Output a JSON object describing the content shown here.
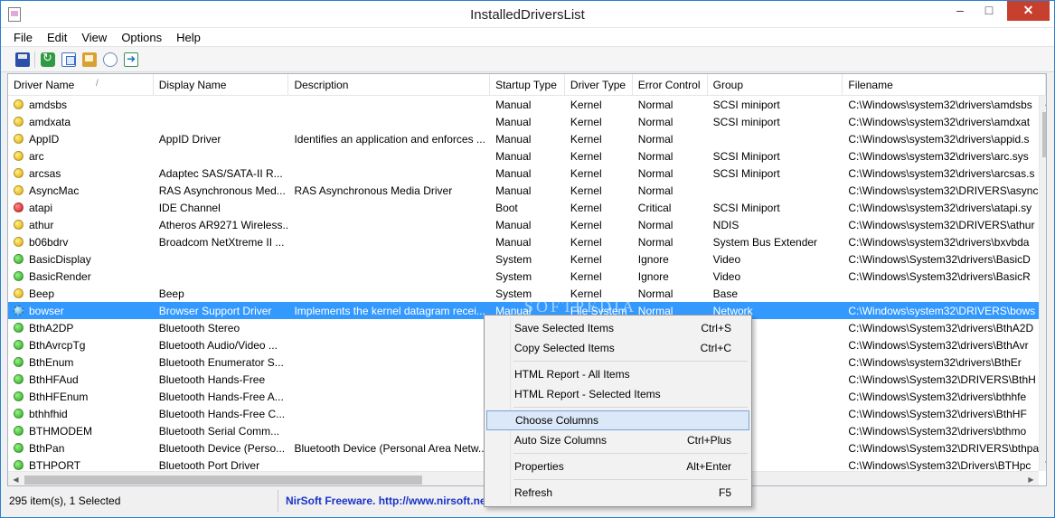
{
  "window": {
    "title": "InstalledDriversList"
  },
  "menu": [
    "File",
    "Edit",
    "View",
    "Options",
    "Help"
  ],
  "toolbar": [
    "save-icon",
    "refresh-icon",
    "copy-icon",
    "properties-icon",
    "find-icon",
    "exit-icon"
  ],
  "columns": [
    "Driver Name",
    "Display Name",
    "Description",
    "Startup Type",
    "Driver Type",
    "Error Control",
    "Group",
    "Filename"
  ],
  "rows": [
    {
      "status": "yellow",
      "cells": [
        "amdsbs",
        "",
        "",
        "Manual",
        "Kernel",
        "Normal",
        "SCSI miniport",
        "C:\\Windows\\system32\\drivers\\amdsbs"
      ]
    },
    {
      "status": "yellow",
      "cells": [
        "amdxata",
        "",
        "",
        "Manual",
        "Kernel",
        "Normal",
        "SCSI miniport",
        "C:\\Windows\\system32\\drivers\\amdxat"
      ]
    },
    {
      "status": "yellow",
      "cells": [
        "AppID",
        "AppID Driver",
        "Identifies an application and enforces ...",
        "Manual",
        "Kernel",
        "Normal",
        "",
        "C:\\Windows\\system32\\drivers\\appid.s"
      ]
    },
    {
      "status": "yellow",
      "cells": [
        "arc",
        "",
        "",
        "Manual",
        "Kernel",
        "Normal",
        "SCSI Miniport",
        "C:\\Windows\\system32\\drivers\\arc.sys"
      ]
    },
    {
      "status": "yellow",
      "cells": [
        "arcsas",
        "Adaptec SAS/SATA-II R...",
        "",
        "Manual",
        "Kernel",
        "Normal",
        "SCSI Miniport",
        "C:\\Windows\\system32\\drivers\\arcsas.s"
      ]
    },
    {
      "status": "yellow",
      "cells": [
        "AsyncMac",
        "RAS Asynchronous Med...",
        "RAS Asynchronous Media Driver",
        "Manual",
        "Kernel",
        "Normal",
        "",
        "C:\\Windows\\system32\\DRIVERS\\asyncr"
      ]
    },
    {
      "status": "red",
      "cells": [
        "atapi",
        "IDE Channel",
        "",
        "Boot",
        "Kernel",
        "Critical",
        "SCSI Miniport",
        "C:\\Windows\\system32\\drivers\\atapi.sy"
      ]
    },
    {
      "status": "yellow",
      "cells": [
        "athur",
        "Atheros AR9271 Wireless...",
        "",
        "Manual",
        "Kernel",
        "Normal",
        "NDIS",
        "C:\\Windows\\system32\\DRIVERS\\athur"
      ]
    },
    {
      "status": "yellow",
      "cells": [
        "b06bdrv",
        "Broadcom NetXtreme II ...",
        "",
        "Manual",
        "Kernel",
        "Normal",
        "System Bus Extender",
        "C:\\Windows\\system32\\drivers\\bxvbda"
      ]
    },
    {
      "status": "green",
      "cells": [
        "BasicDisplay",
        "",
        "",
        "System",
        "Kernel",
        "Ignore",
        "Video",
        "C:\\Windows\\System32\\drivers\\BasicD"
      ]
    },
    {
      "status": "green",
      "cells": [
        "BasicRender",
        "",
        "",
        "System",
        "Kernel",
        "Ignore",
        "Video",
        "C:\\Windows\\System32\\drivers\\BasicR"
      ]
    },
    {
      "status": "yellow",
      "cells": [
        "Beep",
        "Beep",
        "",
        "System",
        "Kernel",
        "Normal",
        "Base",
        ""
      ]
    },
    {
      "status": "gear",
      "selected": true,
      "cells": [
        "bowser",
        "Browser Support Driver",
        "Implements the kernel datagram recei...",
        "Manual",
        "File System",
        "Normal",
        "Network",
        "C:\\Windows\\system32\\DRIVERS\\bows"
      ]
    },
    {
      "status": "green",
      "cells": [
        "BthA2DP",
        "Bluetooth Stereo",
        "",
        "",
        "",
        "",
        "",
        "C:\\Windows\\System32\\drivers\\BthA2D"
      ]
    },
    {
      "status": "green",
      "cells": [
        "BthAvrcpTg",
        "Bluetooth Audio/Video ...",
        "",
        "",
        "",
        "",
        "d Base",
        "C:\\Windows\\System32\\drivers\\BthAvr"
      ]
    },
    {
      "status": "green",
      "cells": [
        "BthEnum",
        "Bluetooth Enumerator S...",
        "",
        "",
        "",
        "",
        "",
        "C:\\Windows\\system32\\drivers\\BthEr"
      ]
    },
    {
      "status": "green",
      "cells": [
        "BthHFAud",
        "Bluetooth Hands-Free",
        "",
        "",
        "",
        "",
        "",
        "C:\\Windows\\System32\\DRIVERS\\BthH"
      ]
    },
    {
      "status": "green",
      "cells": [
        "BthHFEnum",
        "Bluetooth Hands-Free A...",
        "",
        "",
        "",
        "",
        "d Base",
        "C:\\Windows\\System32\\drivers\\bthhfe"
      ]
    },
    {
      "status": "green",
      "cells": [
        "bthhfhid",
        "Bluetooth Hands-Free C...",
        "",
        "",
        "",
        "",
        "",
        "C:\\Windows\\System32\\drivers\\BthHF"
      ]
    },
    {
      "status": "green",
      "cells": [
        "BTHMODEM",
        "Bluetooth Serial Comm...",
        "",
        "",
        "",
        "",
        "",
        "C:\\Windows\\System32\\drivers\\bthmo"
      ]
    },
    {
      "status": "green",
      "cells": [
        "BthPan",
        "Bluetooth Device (Perso...",
        "Bluetooth Device (Personal Area Netw...",
        "",
        "",
        "",
        "",
        "C:\\Windows\\System32\\DRIVERS\\bthpa"
      ]
    },
    {
      "status": "green",
      "cells": [
        "BTHPORT",
        "Bluetooth Port Driver",
        "",
        "",
        "",
        "",
        "er",
        "C:\\Windows\\System32\\Drivers\\BTHpc"
      ]
    }
  ],
  "status": {
    "count": "295 item(s), 1 Selected",
    "credit": "NirSoft Freeware.  http://www.nirsoft.ne"
  },
  "watermark": "SOFTPEDIA",
  "context_menu": [
    {
      "label": "Save Selected Items",
      "shortcut": "Ctrl+S"
    },
    {
      "label": "Copy Selected Items",
      "shortcut": "Ctrl+C"
    },
    {
      "sep": true
    },
    {
      "label": "HTML Report - All Items",
      "shortcut": ""
    },
    {
      "label": "HTML Report - Selected Items",
      "shortcut": ""
    },
    {
      "sep": true
    },
    {
      "label": "Choose Columns",
      "shortcut": "",
      "highlight": true
    },
    {
      "label": "Auto Size Columns",
      "shortcut": "Ctrl+Plus"
    },
    {
      "sep": true
    },
    {
      "label": "Properties",
      "shortcut": "Alt+Enter"
    },
    {
      "sep": true
    },
    {
      "label": "Refresh",
      "shortcut": "F5"
    }
  ]
}
